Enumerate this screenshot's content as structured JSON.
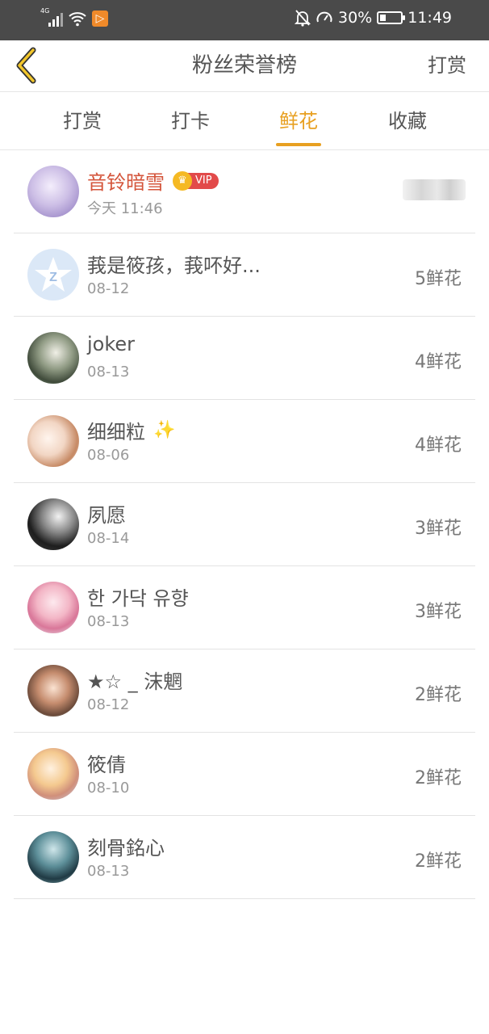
{
  "status_bar": {
    "network": "4G",
    "battery_text": "30%",
    "time": "11:49",
    "battery_level": 0.3,
    "app_badge": "▷"
  },
  "header": {
    "title": "粉丝荣誉榜",
    "action": "打赏"
  },
  "tabs": [
    {
      "label": "打赏",
      "active": false
    },
    {
      "label": "打卡",
      "active": false
    },
    {
      "label": "鲜花",
      "active": true
    },
    {
      "label": "收藏",
      "active": false
    }
  ],
  "current_user": {
    "name": "音铃暗雪",
    "vip_label": "VIP",
    "date": "今天 11:46"
  },
  "fans": [
    {
      "name": "莪是筱孩，莪吥好...",
      "date": "08-12",
      "count": "5鲜花"
    },
    {
      "name": "joker",
      "date": "08-13",
      "count": "4鲜花"
    },
    {
      "name": "细细粒",
      "date": "08-06",
      "count": "4鲜花"
    },
    {
      "name": "夙愿",
      "date": "08-14",
      "count": "3鲜花"
    },
    {
      "name": "한 가닥 유향",
      "date": "08-13",
      "count": "3鲜花"
    },
    {
      "name": "★☆ _ 沫魍",
      "date": "08-12",
      "count": "2鲜花"
    },
    {
      "name": "筱倩",
      "date": "08-10",
      "count": "2鲜花"
    },
    {
      "name": "刻骨銘心",
      "date": "08-13",
      "count": "2鲜花"
    }
  ],
  "colors": {
    "accent": "#e8a021",
    "highlight_name": "#d4553b",
    "status_bar_bg": "#4a4a4a"
  }
}
